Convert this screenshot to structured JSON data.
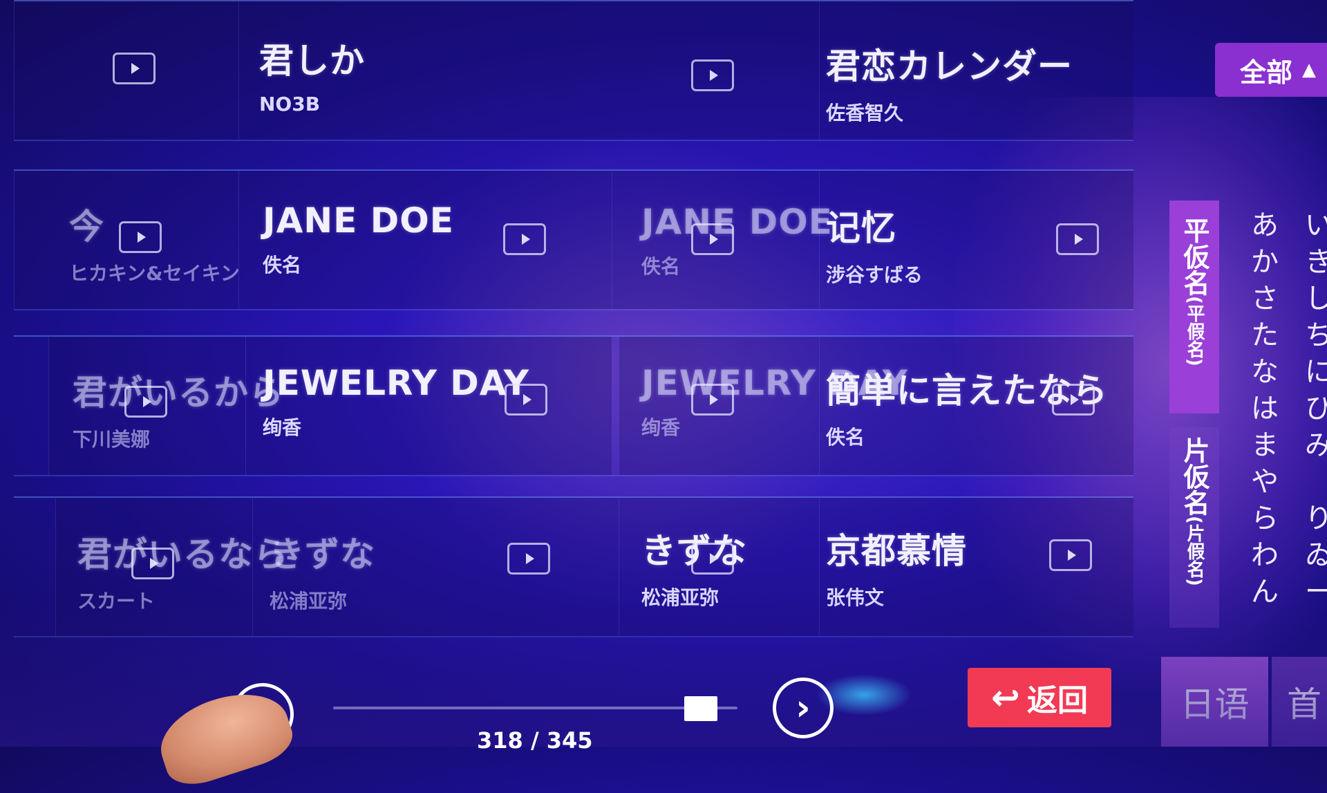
{
  "header": {
    "all_label": "全部"
  },
  "songs": [
    {
      "title": "君しか",
      "artist": "NO3B"
    },
    {
      "title": "君恋カレンダー",
      "artist": "佐香智久"
    },
    {
      "title": "今",
      "artist": "ヒカキン&セイキン"
    },
    {
      "title": "JANE DOE",
      "artist": "佚名"
    },
    {
      "title": "JANE DOE",
      "artist": "佚名"
    },
    {
      "title": "记忆",
      "artist": "涉谷すばる"
    },
    {
      "title": "君がいるから",
      "artist": "下川美娜"
    },
    {
      "title": "JEWELRY DAY",
      "artist": "绚香"
    },
    {
      "title": "JEWELRY DAY",
      "artist": "绚香"
    },
    {
      "title": "簡単に言えたなら",
      "artist": "佚名"
    },
    {
      "title": "君がいるなら",
      "artist": "スカート"
    },
    {
      "title": "きずな",
      "artist": "松浦亚弥"
    },
    {
      "title": "きずな",
      "artist": "松浦亚弥"
    },
    {
      "title": "京都慕情",
      "artist": "张伟文"
    }
  ],
  "kana_tabs": {
    "hiragana": "平仮名",
    "hiragana_sub": "(平假名)",
    "katakana": "片仮名",
    "katakana_sub": "(片假名)"
  },
  "kana_columns": [
    [
      "あ",
      "か",
      "さ",
      "た",
      "な",
      "は",
      "ま",
      "や",
      "ら",
      "わ",
      "ん"
    ],
    [
      "い",
      "き",
      "し",
      "ち",
      "に",
      "ひ",
      "み",
      "",
      "り",
      "ゐ",
      "ー"
    ]
  ],
  "pager": {
    "indicator": "318 / 345",
    "progress": 0.91
  },
  "buttons": {
    "return_label": "返回"
  },
  "language_tabs": [
    "日语",
    "首"
  ]
}
